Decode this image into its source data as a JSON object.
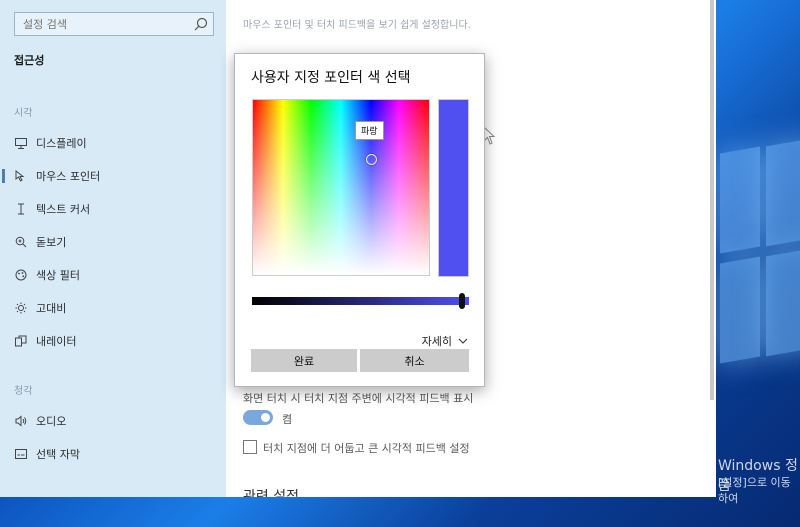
{
  "search": {
    "placeholder": "설정 검색"
  },
  "sidebar": {
    "heading": "접근성",
    "section_vision": "시각",
    "section_hearing": "청각",
    "items": [
      {
        "label": "디스플레이",
        "icon": "monitor-icon"
      },
      {
        "label": "마우스 포인터",
        "icon": "mouse-pointer-icon"
      },
      {
        "label": "텍스트 커서",
        "icon": "text-cursor-icon"
      },
      {
        "label": "돋보기",
        "icon": "magnifier-icon"
      },
      {
        "label": "색상 필터",
        "icon": "color-filter-icon"
      },
      {
        "label": "고대비",
        "icon": "sun-icon"
      },
      {
        "label": "내레이터",
        "icon": "narrator-icon"
      },
      {
        "label": "오디오",
        "icon": "speaker-icon"
      },
      {
        "label": "선택 자막",
        "icon": "captions-icon"
      }
    ]
  },
  "content": {
    "subtitle": "마우스 포인터 및 터치 피드백을 보기 쉽게 설정합니다.",
    "feedback_label": "화면 터치 시 터치 지점 주변에 시각적 피드백 표시",
    "toggle_text": "켬",
    "checkbox_label": "터치 지점에 더 어둡고 큰 시각적 피드백 설정",
    "related": "관련 설정"
  },
  "dialog": {
    "title": "사용자 지정 포인터 색 선택",
    "tooltip": "파랑",
    "more": "자세히",
    "ok": "완료",
    "cancel": "취소",
    "selected_color": "#5050f0"
  },
  "desktop": {
    "activate_title": "Windows 정품",
    "activate_sub": "[설정]으로 이동하여"
  }
}
